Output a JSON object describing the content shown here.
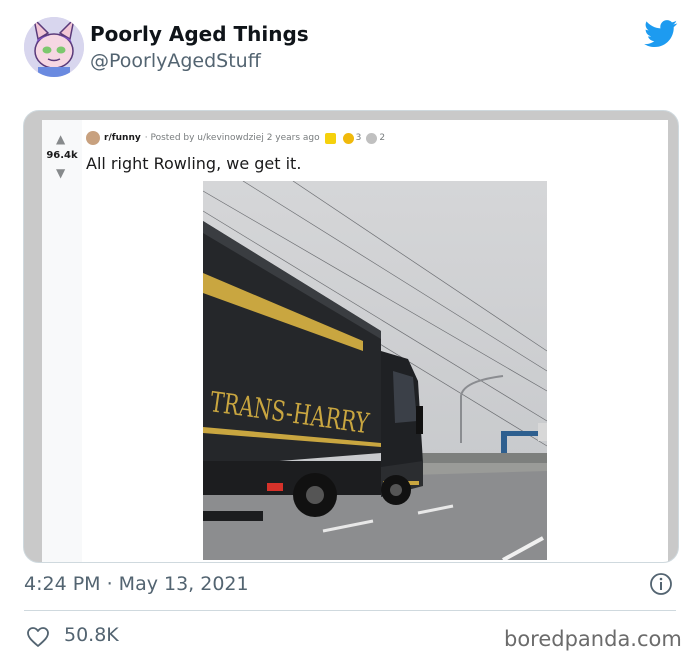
{
  "tweet": {
    "display_name": "Poorly Aged Things",
    "handle": "@PoorlyAgedStuff",
    "avatar_icon": "cartoon-bunny-avatar",
    "brand_icon": "twitter-bird-icon",
    "brand_color": "#1d9bf0",
    "timestamp": "4:24 PM · May 13, 2021",
    "likes": "50.8K"
  },
  "reddit_post": {
    "score": "96.4k",
    "subreddit": "r/funny",
    "posted_by": "· Posted by u/kevinowdziej 2 years ago",
    "award_counts": [
      "3",
      "2"
    ],
    "title": "All right Rowling, we get it."
  },
  "photo": {
    "truck_text": "TRANS-HARRY"
  },
  "watermark": "boredpanda.com"
}
